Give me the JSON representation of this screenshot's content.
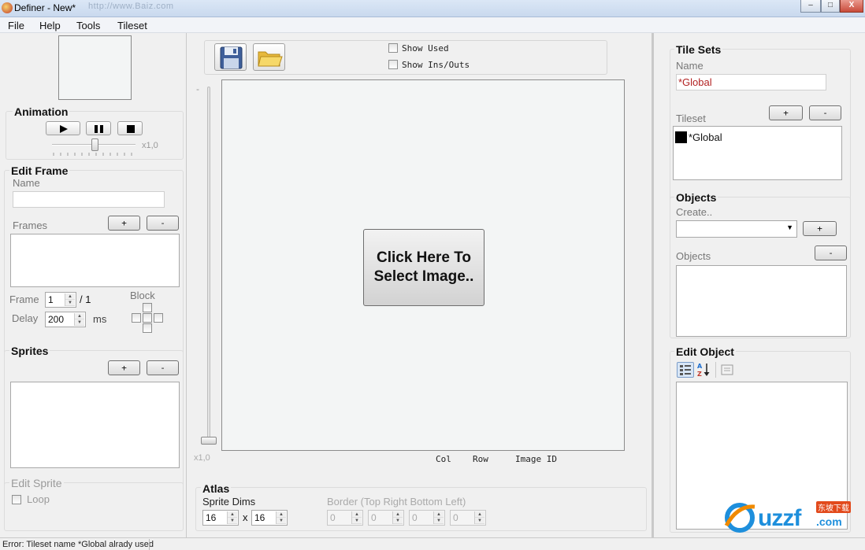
{
  "window": {
    "title": "Definer - New*",
    "ghost_url": "http://www.Baiz.com",
    "controls": [
      "–",
      "□",
      "X"
    ]
  },
  "menu": [
    "File",
    "Help",
    "Tools",
    "Tileset"
  ],
  "animation": {
    "title": "Animation",
    "speed": "x1,0"
  },
  "edit_frame": {
    "title": "Edit Frame",
    "name_label": "Name",
    "frames_label": "Frames",
    "add": "+",
    "remove": "-",
    "frame_label": "Frame",
    "frame_value": "1",
    "frame_total": "/ 1",
    "delay_label": "Delay",
    "delay_value": "200",
    "ms": "ms",
    "block_label": "Block"
  },
  "sprites": {
    "title": "Sprites",
    "add": "+",
    "remove": "-"
  },
  "edit_sprite": {
    "title": "Edit Sprite",
    "loop_label": "Loop"
  },
  "toolbar": {
    "show_used": "Show Used",
    "show_ins_outs": "Show Ins/Outs"
  },
  "canvas": {
    "zoom_dash": "-",
    "zoom": "x1,0",
    "select_image": "Click Here To Select Image..",
    "col": "Col",
    "row": "Row",
    "image_id": "Image ID"
  },
  "atlas": {
    "title": "Atlas",
    "sprite_dims_label": "Sprite Dims",
    "width": "16",
    "x": "x",
    "height": "16",
    "border_label": "Border (Top Right Bottom Left)",
    "border_values": [
      "0",
      "0",
      "0",
      "0"
    ]
  },
  "tile_sets": {
    "title": "Tile Sets",
    "name_label": "Name",
    "name_value": "*Global",
    "add": "+",
    "remove": "-",
    "tileset_label": "Tileset",
    "items": [
      "*Global"
    ]
  },
  "objects": {
    "title": "Objects",
    "create_label": "Create..",
    "add": "+",
    "remove": "-",
    "objects_label": "Objects"
  },
  "edit_object": {
    "title": "Edit Object"
  },
  "watermark": {
    "text": "uzzf",
    "suffix": ".com",
    "badge": "东坡下载"
  },
  "status": {
    "text": "Error: Tileset name *Global alrady used"
  },
  "colors": {
    "accent": "#1e6fd0",
    "error": "#c0392b",
    "watermark_orange": "#f08a00"
  }
}
